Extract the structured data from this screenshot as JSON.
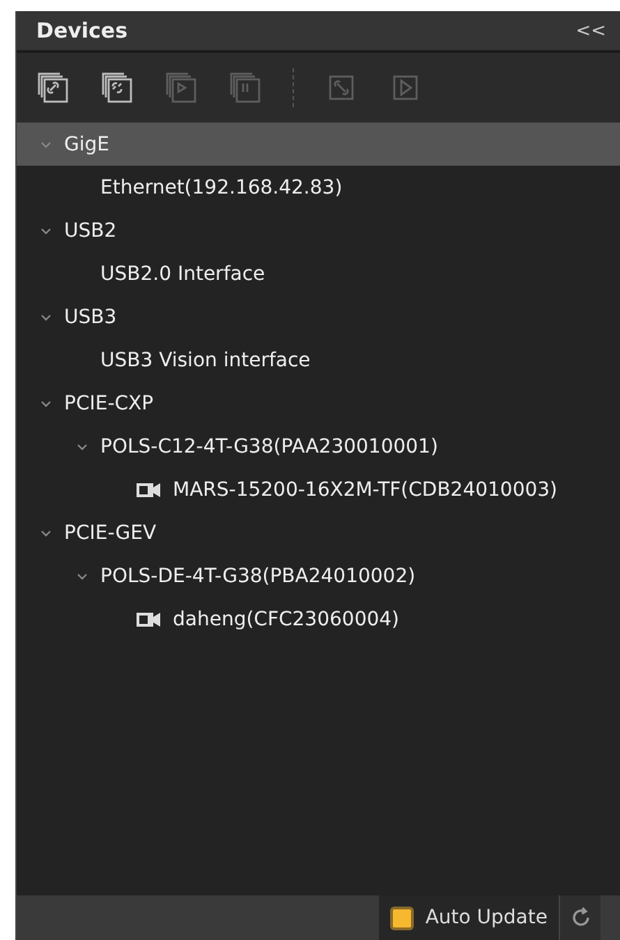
{
  "panel": {
    "title": "Devices",
    "collapse": "<<"
  },
  "toolbar": [
    {
      "kind": "connect",
      "disabled": false
    },
    {
      "kind": "disconnect",
      "disabled": false
    },
    {
      "kind": "start",
      "disabled": true
    },
    {
      "kind": "stop",
      "disabled": true
    },
    {
      "kind": "separator"
    },
    {
      "kind": "link",
      "disabled": true
    },
    {
      "kind": "play",
      "disabled": true
    }
  ],
  "tree": [
    {
      "label": "GigE",
      "expanded": true,
      "selected": true,
      "children": [
        {
          "label": "Ethernet(192.168.42.83)",
          "selected": false
        }
      ]
    },
    {
      "label": "USB2",
      "expanded": true,
      "selected": false,
      "children": [
        {
          "label": "USB2.0 Interface",
          "selected": false
        }
      ]
    },
    {
      "label": "USB3",
      "expanded": true,
      "selected": false,
      "children": [
        {
          "label": "USB3 Vision interface",
          "selected": false
        }
      ]
    },
    {
      "label": "PCIE-CXP",
      "expanded": true,
      "selected": false,
      "children": [
        {
          "label": "POLS-C12-4T-G38(PAA230010001)",
          "expanded": true,
          "selected": false,
          "children": [
            {
              "label": "MARS-15200-16X2M-TF(CDB24010003)",
              "kind": "camera",
              "selected": false
            }
          ]
        }
      ]
    },
    {
      "label": "PCIE-GEV",
      "expanded": true,
      "selected": false,
      "children": [
        {
          "label": "POLS-DE-4T-G38(PBA24010002)",
          "expanded": true,
          "selected": false,
          "children": [
            {
              "label": "daheng(CFC23060004)",
              "kind": "camera",
              "selected": false
            }
          ]
        }
      ]
    }
  ],
  "footer": {
    "auto_update": {
      "label": "Auto Update",
      "checked": true
    }
  }
}
